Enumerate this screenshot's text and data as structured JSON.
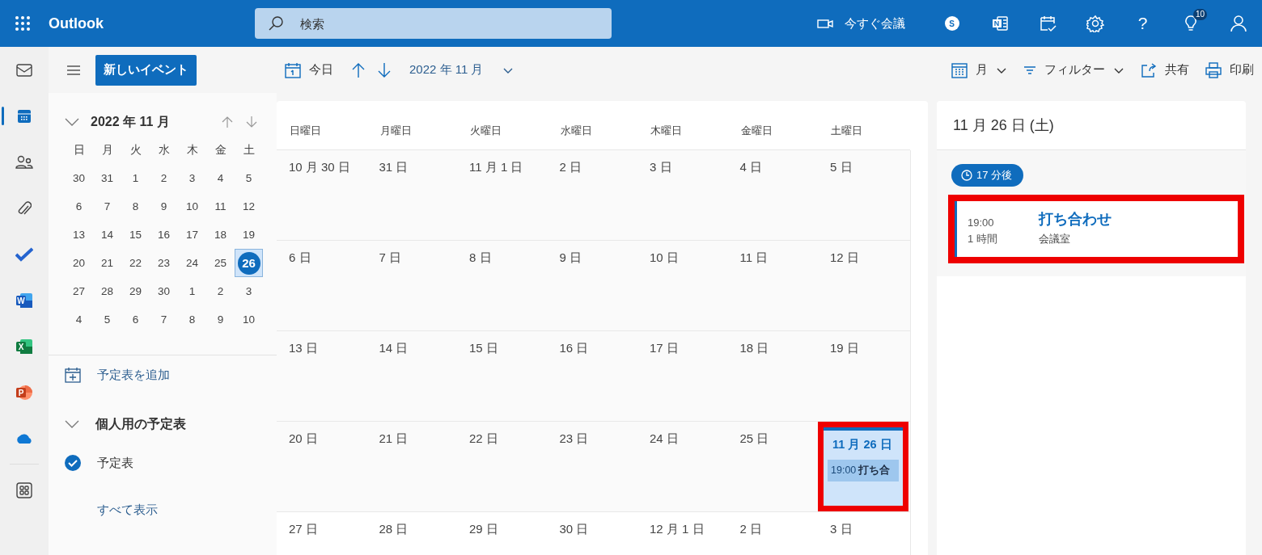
{
  "top_bar": {
    "app_name": "Outlook",
    "search": {
      "placeholder": "検索"
    },
    "meet_now": "今すぐ会議",
    "actions": [
      {
        "kind": "skype",
        "letter": "S"
      },
      {
        "kind": "onenote",
        "letter": "N"
      },
      {
        "kind": "calendar_check"
      },
      {
        "kind": "settings"
      },
      {
        "kind": "help",
        "glyph": "?"
      },
      {
        "kind": "tips",
        "badge": "10"
      },
      {
        "kind": "account"
      }
    ]
  },
  "rail": [
    {
      "kind": "mail",
      "selected": false
    },
    {
      "kind": "calendar",
      "selected": true
    },
    {
      "kind": "people",
      "selected": false
    },
    {
      "kind": "attach",
      "selected": false
    },
    {
      "kind": "todo",
      "selected": false
    },
    {
      "kind": "word",
      "letter": "W",
      "selected": false
    },
    {
      "kind": "excel",
      "letter": "X",
      "selected": false
    },
    {
      "kind": "powerpoint",
      "letter": "P",
      "selected": false
    },
    {
      "kind": "onedrive",
      "selected": false
    },
    {
      "kind": "apps",
      "selected": false
    }
  ],
  "toolbar": {
    "new_event": "新しいイベント",
    "today": "今日",
    "period": "2022 年 11 月",
    "view": "月",
    "filter": "フィルター",
    "share": "共有",
    "print": "印刷"
  },
  "mini_calendar": {
    "title": "2022 年 11 月",
    "weekdays": [
      "日",
      "月",
      "火",
      "水",
      "木",
      "金",
      "土"
    ],
    "weeks": [
      [
        {
          "day": "30",
          "selected": false
        },
        {
          "day": "31",
          "selected": false
        },
        {
          "day": "1",
          "selected": false
        },
        {
          "day": "2",
          "selected": false
        },
        {
          "day": "3",
          "selected": false
        },
        {
          "day": "4",
          "selected": false
        },
        {
          "day": "5",
          "selected": false
        }
      ],
      [
        {
          "day": "6",
          "selected": false
        },
        {
          "day": "7",
          "selected": false
        },
        {
          "day": "8",
          "selected": false
        },
        {
          "day": "9",
          "selected": false
        },
        {
          "day": "10",
          "selected": false
        },
        {
          "day": "11",
          "selected": false
        },
        {
          "day": "12",
          "selected": false
        }
      ],
      [
        {
          "day": "13",
          "selected": false
        },
        {
          "day": "14",
          "selected": false
        },
        {
          "day": "15",
          "selected": false
        },
        {
          "day": "16",
          "selected": false
        },
        {
          "day": "17",
          "selected": false
        },
        {
          "day": "18",
          "selected": false
        },
        {
          "day": "19",
          "selected": false
        }
      ],
      [
        {
          "day": "20",
          "selected": false
        },
        {
          "day": "21",
          "selected": false
        },
        {
          "day": "22",
          "selected": false
        },
        {
          "day": "23",
          "selected": false
        },
        {
          "day": "24",
          "selected": false
        },
        {
          "day": "25",
          "selected": false
        },
        {
          "day": "26",
          "selected": true
        }
      ],
      [
        {
          "day": "27",
          "selected": false
        },
        {
          "day": "28",
          "selected": false
        },
        {
          "day": "29",
          "selected": false
        },
        {
          "day": "30",
          "selected": false
        },
        {
          "day": "1",
          "selected": false
        },
        {
          "day": "2",
          "selected": false
        },
        {
          "day": "3",
          "selected": false
        }
      ],
      [
        {
          "day": "4",
          "selected": false
        },
        {
          "day": "5",
          "selected": false
        },
        {
          "day": "6",
          "selected": false
        },
        {
          "day": "7",
          "selected": false
        },
        {
          "day": "8",
          "selected": false
        },
        {
          "day": "9",
          "selected": false
        },
        {
          "day": "10",
          "selected": false
        }
      ]
    ]
  },
  "calendars": {
    "add_calendar": "予定表を追加",
    "group": {
      "title": "個人用の予定表",
      "expanded": true,
      "items": [
        {
          "label": "予定表",
          "checked": true
        }
      ]
    },
    "show_all": "すべて表示"
  },
  "month_grid": {
    "weekdays": [
      "日曜日",
      "月曜日",
      "火曜日",
      "水曜日",
      "木曜日",
      "金曜日",
      "土曜日"
    ],
    "weeks": [
      [
        {
          "label": "10 月 30 日",
          "selected": false
        },
        {
          "label": "31 日",
          "selected": false
        },
        {
          "label": "11 月 1 日",
          "selected": false
        },
        {
          "label": "2 日",
          "selected": false
        },
        {
          "label": "3 日",
          "selected": false
        },
        {
          "label": "4 日",
          "selected": false
        },
        {
          "label": "5 日",
          "selected": false
        }
      ],
      [
        {
          "label": "6 日",
          "selected": false
        },
        {
          "label": "7 日",
          "selected": false
        },
        {
          "label": "8 日",
          "selected": false
        },
        {
          "label": "9 日",
          "selected": false
        },
        {
          "label": "10 日",
          "selected": false
        },
        {
          "label": "11 日",
          "selected": false
        },
        {
          "label": "12 日",
          "selected": false
        }
      ],
      [
        {
          "label": "13 日",
          "selected": false
        },
        {
          "label": "14 日",
          "selected": false
        },
        {
          "label": "15 日",
          "selected": false
        },
        {
          "label": "16 日",
          "selected": false
        },
        {
          "label": "17 日",
          "selected": false
        },
        {
          "label": "18 日",
          "selected": false
        },
        {
          "label": "19 日",
          "selected": false
        }
      ],
      [
        {
          "label": "20 日",
          "selected": false
        },
        {
          "label": "21 日",
          "selected": false
        },
        {
          "label": "22 日",
          "selected": false
        },
        {
          "label": "23 日",
          "selected": false
        },
        {
          "label": "24 日",
          "selected": false
        },
        {
          "label": "25 日",
          "selected": false
        },
        {
          "label": "11 月 26 日",
          "selected": true,
          "highlighted": true,
          "events": [
            {
              "time": "19:00",
              "title": "打ち合"
            }
          ]
        }
      ],
      [
        {
          "label": "27 日",
          "selected": false
        },
        {
          "label": "28 日",
          "selected": false
        },
        {
          "label": "29 日",
          "selected": false
        },
        {
          "label": "30 日",
          "selected": false
        },
        {
          "label": "12 月 1 日",
          "selected": false
        },
        {
          "label": "2 日",
          "selected": false
        },
        {
          "label": "3 日",
          "selected": false
        }
      ]
    ]
  },
  "agenda": {
    "date_title": "11 月 26 日 (土)",
    "countdown": "17 分後",
    "events": [
      {
        "time": "19:00",
        "duration": "1 時間",
        "title": "打ち合わせ",
        "location": "会議室",
        "highlighted": true
      }
    ]
  }
}
